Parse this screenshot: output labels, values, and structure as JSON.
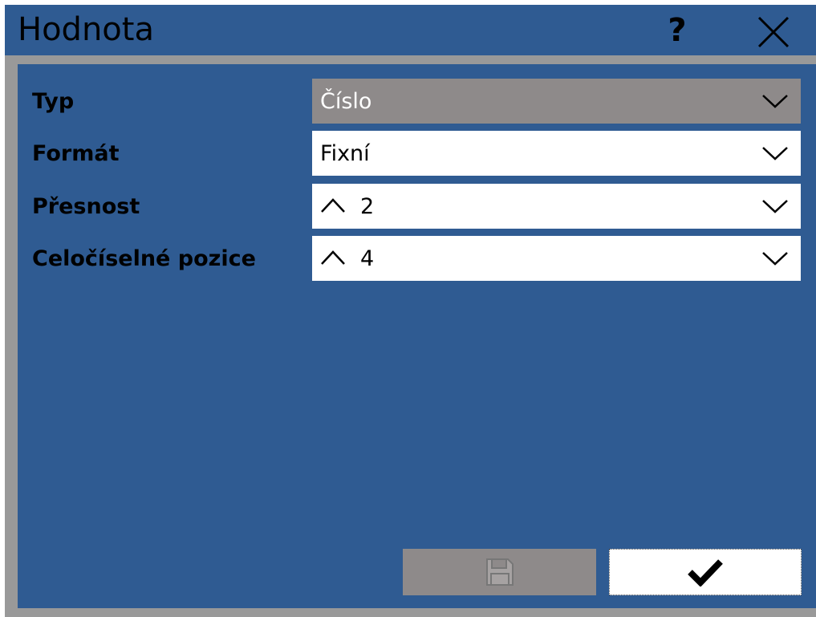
{
  "dialog": {
    "title": "Hodnota"
  },
  "titlebar": {
    "help_label": "?",
    "help_icon": "question-mark-icon",
    "close_icon": "close-icon"
  },
  "fields": {
    "type": {
      "label": "Typ",
      "value": "Číslo",
      "enabled": false
    },
    "format": {
      "label": "Formát",
      "value": "Fixní",
      "enabled": true
    },
    "precision": {
      "label": "Přesnost",
      "value": "2",
      "enabled": true
    },
    "integer_positions": {
      "label": "Celočíselné pozice",
      "value": "4",
      "enabled": true
    }
  },
  "buttons": {
    "save": {
      "icon": "floppy-disk-icon",
      "enabled": false
    },
    "confirm": {
      "icon": "checkmark-icon",
      "enabled": true
    }
  },
  "colors": {
    "background": "#2f5b92",
    "frame": "#999999",
    "disabled": "#8e8a8a",
    "field": "#ffffff"
  }
}
